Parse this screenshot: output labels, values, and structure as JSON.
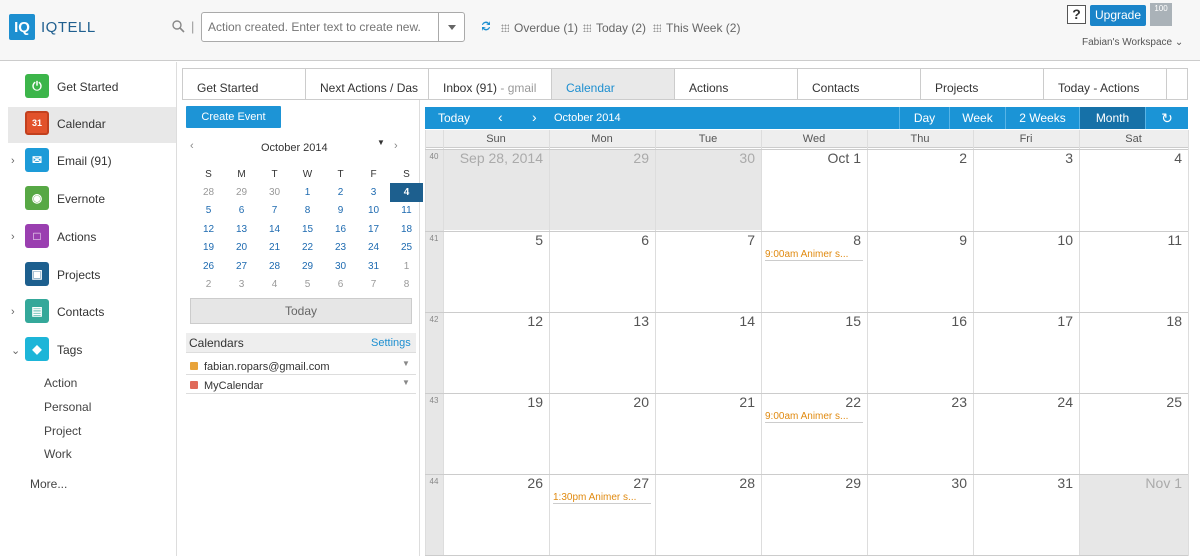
{
  "app": {
    "logo_mark": "IQ",
    "name": "IQTELL"
  },
  "quick_entry": {
    "placeholder": "Action created. Enter text to create new."
  },
  "filters": [
    {
      "label": "Overdue (1)"
    },
    {
      "label": "Today (2)"
    },
    {
      "label": "This Week (2)"
    }
  ],
  "top_right": {
    "help": "?",
    "upgrade": "Upgrade",
    "badge": "100",
    "workspace": "Fabian's Workspace"
  },
  "sidebar": {
    "items": [
      {
        "label": "Get Started",
        "icon": "power-icon",
        "color": "#3cb54a"
      },
      {
        "label": "Calendar",
        "icon": "calendar-icon",
        "color": "#e2522b"
      },
      {
        "label": "Email (91)",
        "icon": "mail-icon",
        "color": "#1d9bd8"
      },
      {
        "label": "Evernote",
        "icon": "evernote-icon",
        "color": "#57a845"
      },
      {
        "label": "Actions",
        "icon": "clipboard-icon",
        "color": "#9a3fb0"
      },
      {
        "label": "Projects",
        "icon": "hierarchy-icon",
        "color": "#1d5f8e"
      },
      {
        "label": "Contacts",
        "icon": "addressbook-icon",
        "color": "#34a89a"
      },
      {
        "label": "Tags",
        "icon": "tag-icon",
        "color": "#1db5d8"
      }
    ],
    "tags": [
      "Action",
      "Personal",
      "Project",
      "Work"
    ],
    "more": "More..."
  },
  "tabs": [
    {
      "label": "Get Started",
      "sub": ""
    },
    {
      "label": "Next Actions / Das",
      "sub": ""
    },
    {
      "label": "Inbox (91)",
      "sub": " - gmail"
    },
    {
      "label": "Calendar",
      "sub": ""
    },
    {
      "label": "Actions",
      "sub": ""
    },
    {
      "label": "Contacts",
      "sub": ""
    },
    {
      "label": "Projects",
      "sub": ""
    },
    {
      "label": "Today - Actions",
      "sub": ""
    }
  ],
  "left_pane": {
    "create_event": "Create Event",
    "mini_title": "October 2014",
    "weekday_headers": [
      "S",
      "M",
      "T",
      "W",
      "T",
      "F",
      "S"
    ],
    "mini_weeks": [
      [
        "28",
        "29",
        "30",
        "1",
        "2",
        "3",
        "4"
      ],
      [
        "5",
        "6",
        "7",
        "8",
        "9",
        "10",
        "11"
      ],
      [
        "12",
        "13",
        "14",
        "15",
        "16",
        "17",
        "18"
      ],
      [
        "19",
        "20",
        "21",
        "22",
        "23",
        "24",
        "25"
      ],
      [
        "26",
        "27",
        "28",
        "29",
        "30",
        "31",
        "1"
      ],
      [
        "2",
        "3",
        "4",
        "5",
        "6",
        "7",
        "8"
      ]
    ],
    "today_button": "Today",
    "calendars_label": "Calendars",
    "settings_label": "Settings",
    "calendars": [
      {
        "name": "fabian.ropars@gmail.com",
        "color": "#e8a33a"
      },
      {
        "name": "MyCalendar",
        "color": "#e06a5a"
      }
    ]
  },
  "calendar": {
    "toolbar": {
      "today": "Today",
      "title": "October 2014",
      "views": [
        "Day",
        "Week",
        "2 Weeks",
        "Month"
      ],
      "active_view": "Month"
    },
    "weekdays": [
      "Sun",
      "Mon",
      "Tue",
      "Wed",
      "Thu",
      "Fri",
      "Sat"
    ],
    "weeks": [
      {
        "num": "40",
        "days": [
          "Sep 28, 2014",
          "29",
          "30",
          "Oct 1",
          "2",
          "3",
          "4"
        ]
      },
      {
        "num": "41",
        "days": [
          "5",
          "6",
          "7",
          "8",
          "9",
          "10",
          "11"
        ]
      },
      {
        "num": "42",
        "days": [
          "12",
          "13",
          "14",
          "15",
          "16",
          "17",
          "18"
        ]
      },
      {
        "num": "43",
        "days": [
          "19",
          "20",
          "21",
          "22",
          "23",
          "24",
          "25"
        ]
      },
      {
        "num": "44",
        "days": [
          "26",
          "27",
          "28",
          "29",
          "30",
          "31",
          "Nov 1"
        ]
      }
    ],
    "events": [
      {
        "week": 1,
        "day": 3,
        "label": "9:00am Animer s..."
      },
      {
        "week": 3,
        "day": 3,
        "label": "9:00am Animer s..."
      },
      {
        "week": 4,
        "day": 1,
        "label": "1:30pm Animer s..."
      }
    ]
  }
}
